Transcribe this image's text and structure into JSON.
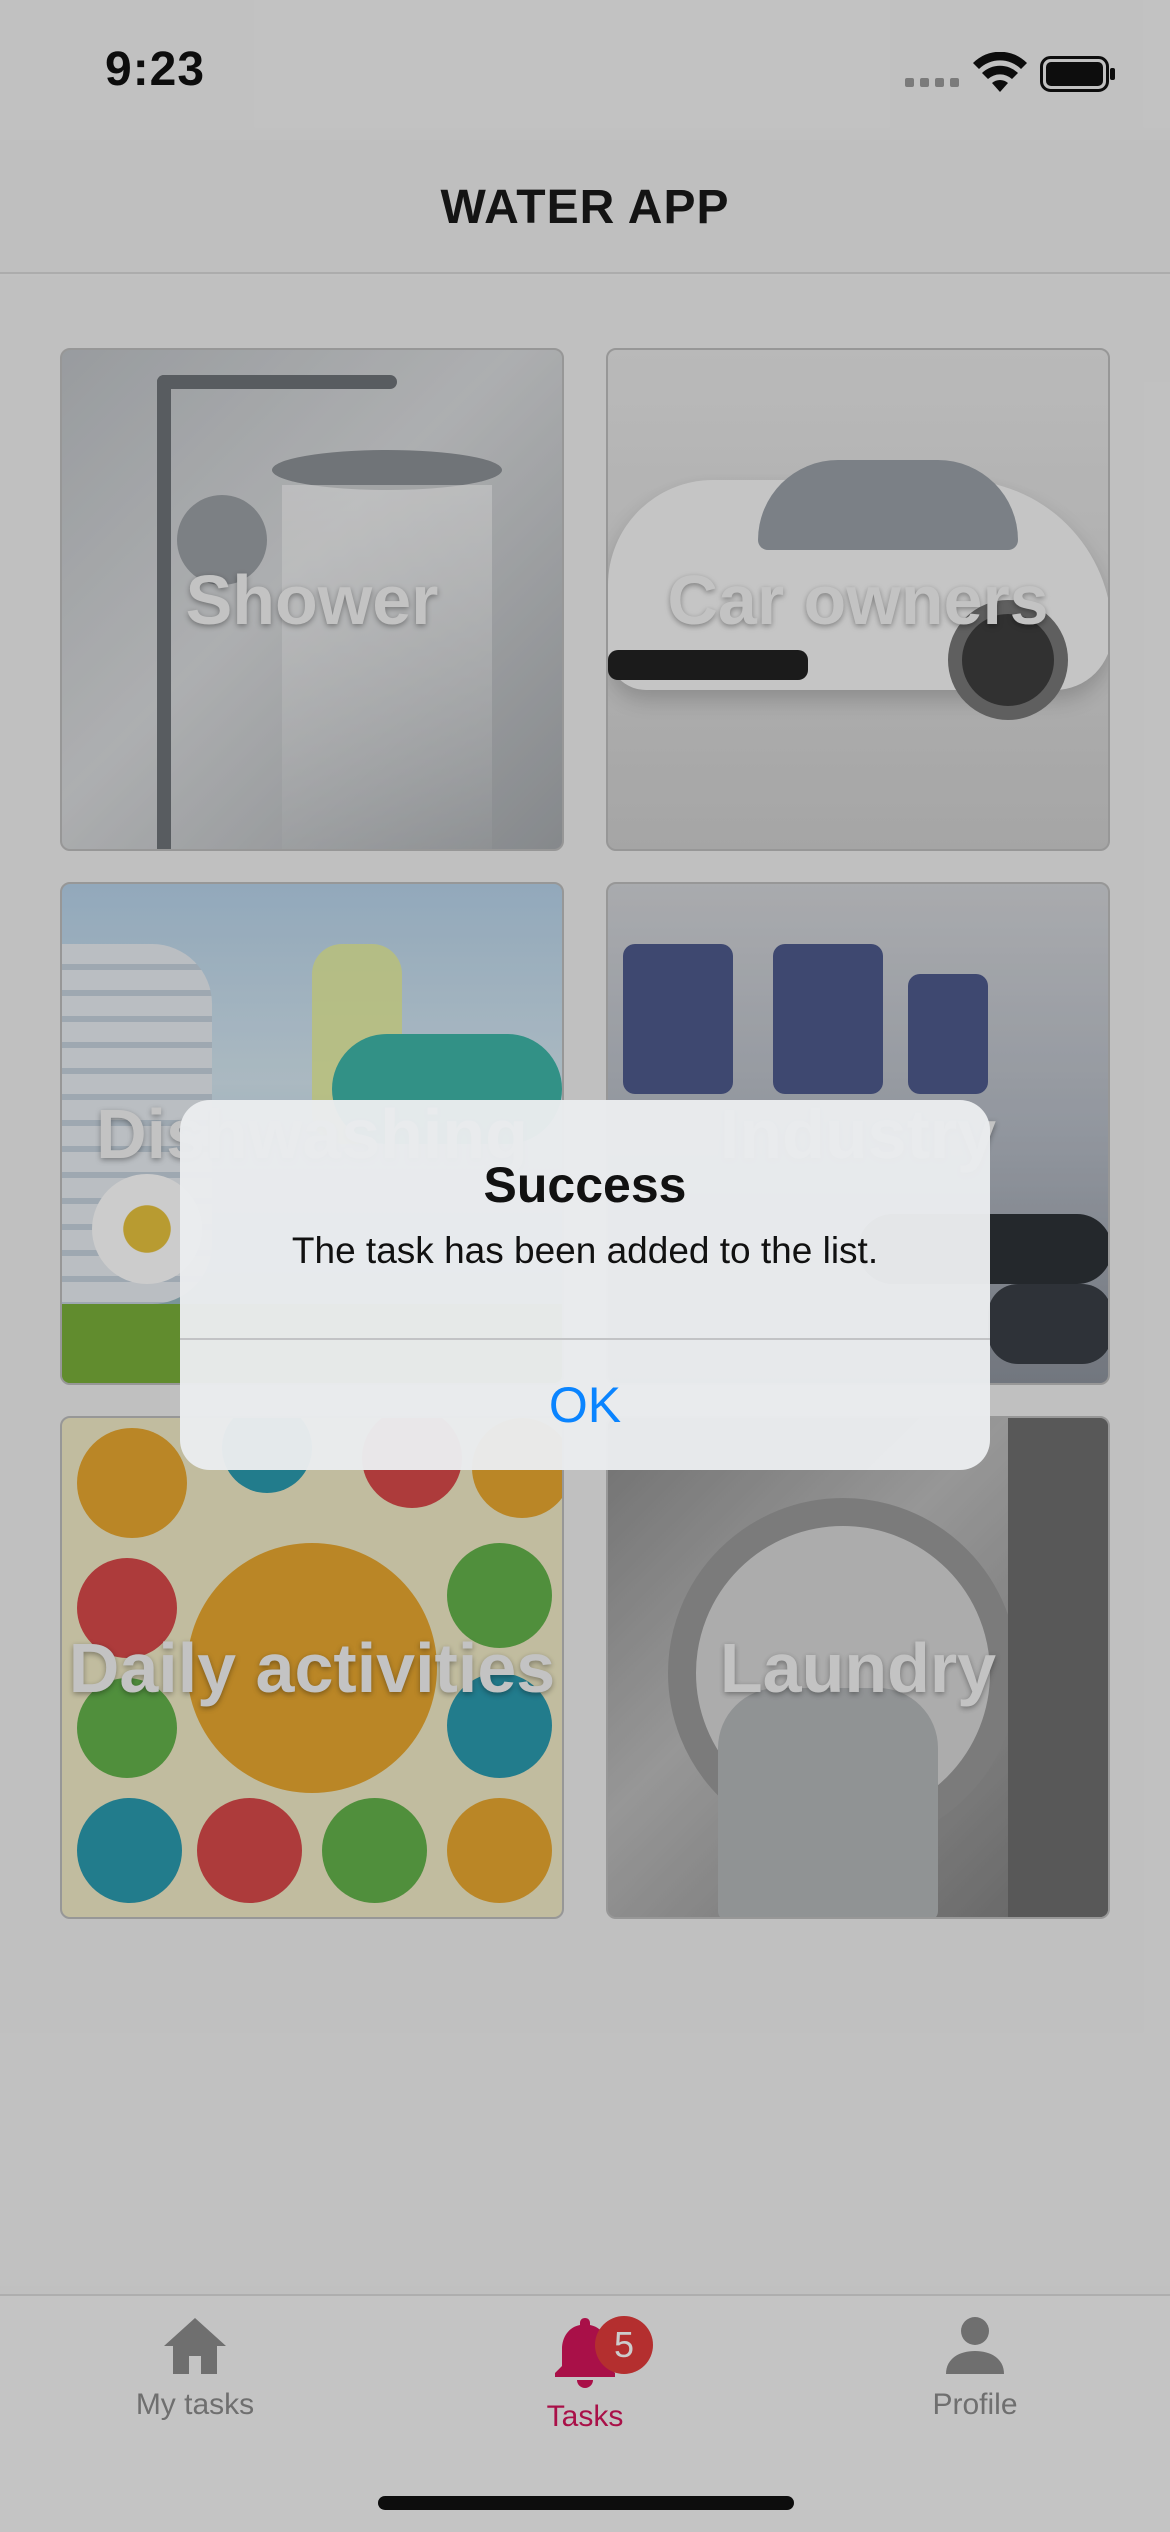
{
  "status_bar": {
    "time": "9:23"
  },
  "header": {
    "title": "WATER APP"
  },
  "tiles": [
    {
      "label": "Shower"
    },
    {
      "label": "Car owners"
    },
    {
      "label": "Dishwashing"
    },
    {
      "label": "Industry"
    },
    {
      "label": "Daily activities"
    },
    {
      "label": "Laundry"
    }
  ],
  "tab_bar": {
    "items": [
      {
        "label": "My tasks",
        "icon": "home-icon"
      },
      {
        "label": "Tasks",
        "icon": "bell-icon",
        "badge": "5",
        "active": true
      },
      {
        "label": "Profile",
        "icon": "person-icon"
      }
    ],
    "active_color": "#d4145a",
    "inactive_color": "#8b8b8b"
  },
  "alert": {
    "title": "Success",
    "message": "The task has been added to the list.",
    "ok_label": "OK",
    "ok_color": "#0a84ff"
  }
}
